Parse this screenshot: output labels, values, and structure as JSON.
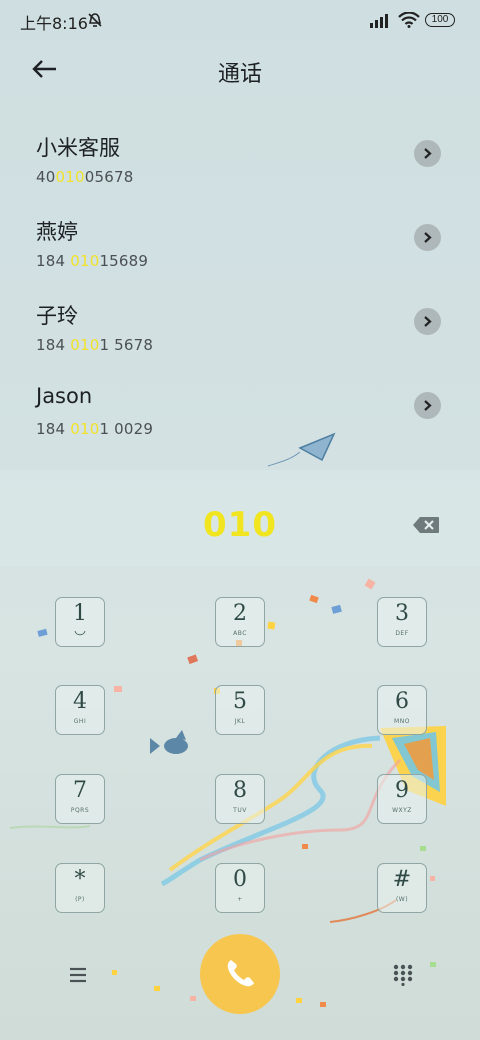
{
  "status_bar": {
    "time": "上午8:16",
    "battery": "100",
    "icons": [
      "mute-icon",
      "signal-icon",
      "wifi-icon",
      "battery-icon"
    ]
  },
  "header": {
    "title": "通话",
    "back_icon": "back-arrow-icon"
  },
  "contacts": [
    {
      "name": "小米客服",
      "number_pre": "40",
      "number_hl": "010",
      "number_post": "05678"
    },
    {
      "name": "燕婷",
      "number_pre": "184 ",
      "number_hl": "010",
      "number_post": "15689"
    },
    {
      "name": "子玲",
      "number_pre": "184 ",
      "number_hl": "010",
      "number_post": "1 5678"
    },
    {
      "name": "Jason",
      "number_pre": "184 ",
      "number_hl": "010",
      "number_post": "1 0029"
    }
  ],
  "dialer": {
    "dialed": "010",
    "highlight_color": "#f0e51f",
    "keys": [
      {
        "digit": "1",
        "letters": ""
      },
      {
        "digit": "2",
        "letters": "ABC"
      },
      {
        "digit": "3",
        "letters": "DEF"
      },
      {
        "digit": "4",
        "letters": "GHI"
      },
      {
        "digit": "5",
        "letters": "JKL"
      },
      {
        "digit": "6",
        "letters": "MNO"
      },
      {
        "digit": "7",
        "letters": "PQRS"
      },
      {
        "digit": "8",
        "letters": "TUV"
      },
      {
        "digit": "9",
        "letters": "WXYZ"
      },
      {
        "digit": "*",
        "letters": "(P)"
      },
      {
        "digit": "0",
        "letters": "+"
      },
      {
        "digit": "#",
        "letters": "(W)"
      }
    ]
  },
  "bottom_bar": {
    "menu_icon": "menu-icon",
    "call_icon": "phone-icon",
    "call_color": "#f7c64e",
    "dialpad_icon": "dialpad-icon"
  }
}
